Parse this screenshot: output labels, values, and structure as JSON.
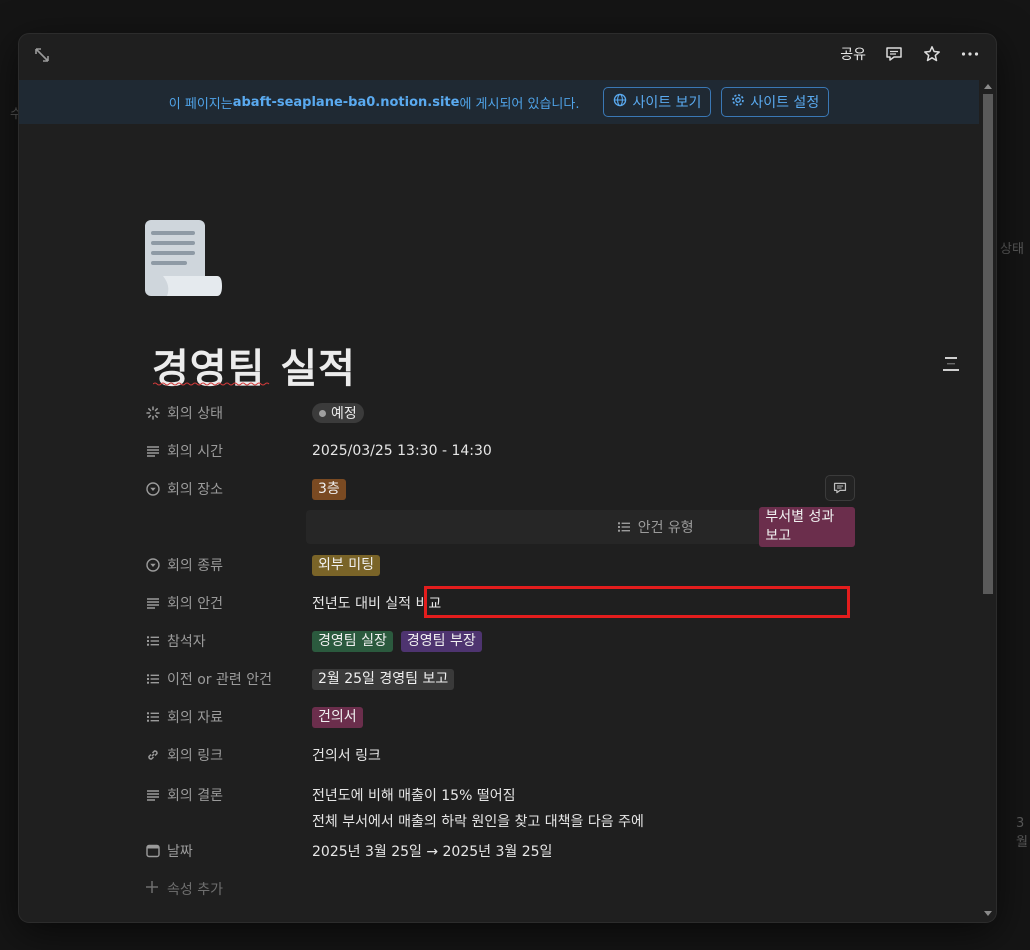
{
  "background": {
    "left_fragment": "수",
    "right_fragment": "상태",
    "bottom_right_fragment": "3월"
  },
  "topbar": {
    "share_label": "공유",
    "icons": [
      "expand-icon",
      "comment-icon",
      "star-icon",
      "more-icon"
    ]
  },
  "banner": {
    "prefix": "이 페이지는 ",
    "domain": "abaft-seaplane-ba0.notion.site",
    "suffix": "에 게시되어 있습니다.",
    "view_site_label": "사이트 보기",
    "site_settings_label": "사이트 설정"
  },
  "page": {
    "icon": "document-scroll-icon",
    "title": "경영팀 실적"
  },
  "properties": [
    {
      "label": "회의 상태",
      "icon": "status-icon",
      "type": "status",
      "value": "예정"
    },
    {
      "label": "회의 시간",
      "icon": "text-icon",
      "type": "text",
      "value": "2025/03/25 13:30 - 14:30"
    },
    {
      "label": "회의 장소",
      "icon": "select-icon",
      "type": "select",
      "tags": [
        {
          "text": "3층",
          "color": "#7a4a22"
        }
      ]
    },
    {
      "label": "안건 유형",
      "icon": "list-icon",
      "type": "multi",
      "tags": [
        {
          "text": "부서별 성과 보고",
          "color": "#6b2e4c"
        }
      ]
    },
    {
      "label": "회의 종류",
      "icon": "select-icon",
      "type": "select",
      "tags": [
        {
          "text": "외부 미팅",
          "color": "#7a6428"
        }
      ]
    },
    {
      "label": "회의 안건",
      "icon": "text-icon",
      "type": "text",
      "value": "전년도 대비 실적 비교"
    },
    {
      "label": "참석자",
      "icon": "list-icon",
      "type": "multi",
      "tags": [
        {
          "text": "경영팀 실장",
          "color": "#2b5a3e"
        },
        {
          "text": "경영팀 부장",
          "color": "#4e3470"
        }
      ]
    },
    {
      "label": "이전 or 관련 안건",
      "icon": "list-icon",
      "type": "multi",
      "tags": [
        {
          "text": "2월 25일 경영팀 보고",
          "color": "#3a3a3a"
        }
      ]
    },
    {
      "label": "회의 자료",
      "icon": "list-icon",
      "type": "multi",
      "tags": [
        {
          "text": "건의서",
          "color": "#6b2e4c"
        }
      ]
    },
    {
      "label": "회의 링크",
      "icon": "link-icon",
      "type": "text",
      "value": "건의서 링크"
    },
    {
      "label": "회의 결론",
      "icon": "text-icon",
      "type": "multiline",
      "lines": [
        "전년도에 비해 매출이 15% 떨어짐",
        "전체 부서에서 매출의 하락 원인을 찾고 대책을 다음 주에"
      ]
    },
    {
      "label": "날짜",
      "icon": "calendar-icon",
      "type": "text",
      "value": "2025년 3월 25일 → 2025년 3월 25일"
    }
  ],
  "add_property_label": "속성 추가",
  "colors": {
    "accent": "#4fa3e8",
    "highlight_box": "#e31d1d"
  }
}
